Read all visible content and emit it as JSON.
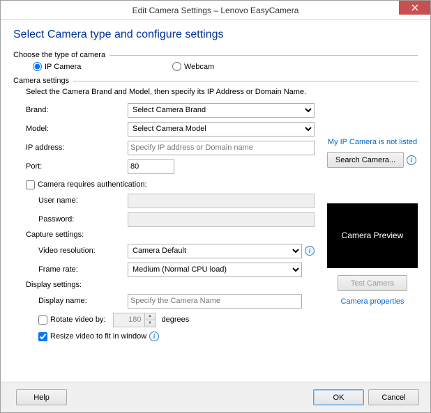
{
  "window": {
    "title": "Edit Camera Settings – Lenovo EasyCamera"
  },
  "heading": "Select Camera type and configure settings",
  "group_type": {
    "label": "Choose the type of camera",
    "opt_ip": "IP Camera",
    "opt_webcam": "Webcam"
  },
  "group_settings": {
    "label": "Camera settings",
    "instruction": "Select the Camera Brand and Model, then specify its IP Address or Domain Name.",
    "brand_label": "Brand:",
    "brand_value": "Select Camera Brand",
    "model_label": "Model:",
    "model_value": "Select Camera Model",
    "ip_label": "IP address:",
    "ip_placeholder": "Specify IP address or Domain name",
    "port_label": "Port:",
    "port_value": "80",
    "auth_label": "Camera requires authentication:",
    "user_label": "User name:",
    "pass_label": "Password:",
    "not_listed_link": "My IP Camera is not listed",
    "search_btn": "Search Camera..."
  },
  "capture": {
    "label": "Capture settings:",
    "res_label": "Video resolution:",
    "res_value": "Camera Default",
    "fps_label": "Frame rate:",
    "fps_value": "Medium (Normal CPU load)"
  },
  "preview": {
    "text": "Camera Preview",
    "test_btn": "Test Camera",
    "props_link": "Camera properties"
  },
  "display": {
    "label": "Display settings:",
    "name_label": "Display name:",
    "name_placeholder": "Specify the Camera Name",
    "rotate_label": "Rotate video by:",
    "rotate_value": "180",
    "rotate_unit": "degrees",
    "resize_label": "Resize video to fit in window"
  },
  "footer": {
    "help": "Help",
    "ok": "OK",
    "cancel": "Cancel"
  }
}
